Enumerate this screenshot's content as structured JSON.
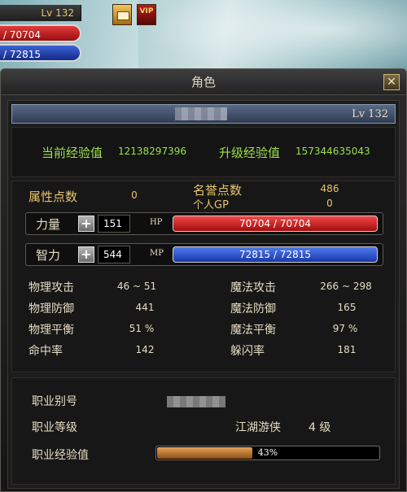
{
  "hud": {
    "level": "Lv 132",
    "hp_text": "/ 70704",
    "mp_text": "/ 72815",
    "icons": [
      "scroll-icon",
      "vip-icon"
    ],
    "vip_label": "VIP"
  },
  "window": {
    "title": "角色",
    "close_label": "✕"
  },
  "character": {
    "name": "",
    "level": "Lv 132"
  },
  "experience": {
    "current_label": "当前经验值",
    "current_value": "12138297396",
    "next_label": "升级经验值",
    "next_value": "157344635043"
  },
  "points": {
    "attr_label": "属性点数",
    "attr_value": "0",
    "fame_label": "名誉点数",
    "fame_value": "486",
    "gp_label": "个人GP",
    "gp_value": "0"
  },
  "stats": {
    "str_label": "力量",
    "str_value": "151",
    "int_label": "智力",
    "int_value": "544",
    "plus": "+"
  },
  "bars": {
    "hp_tag": "HP",
    "hp_text": "70704 / 70704",
    "hp_fraction": 1.0,
    "mp_tag": "MP",
    "mp_text": "72815 / 72815",
    "mp_fraction": 1.0
  },
  "combat": [
    {
      "label": "物理攻击",
      "value": "46 ~ 51"
    },
    {
      "label": "魔法攻击",
      "value": "266 ~ 298"
    },
    {
      "label": "物理防御",
      "value": "441"
    },
    {
      "label": "魔法防御",
      "value": "165"
    },
    {
      "label": "物理平衡",
      "value": "51 %"
    },
    {
      "label": "魔法平衡",
      "value": "97 %"
    },
    {
      "label": "命中率",
      "value": "142"
    },
    {
      "label": "躲闪率",
      "value": "181"
    }
  ],
  "job": {
    "alias_label": "职业别号",
    "alias_value": "",
    "level_label": "职业等级",
    "class_name": "江湖游侠",
    "class_level": "4 级",
    "exp_label": "职业经验值",
    "exp_percent": 43,
    "exp_text": "43%"
  },
  "colors": {
    "accent_gold": "#e8c56a",
    "exp_green": "#9ee04c",
    "hp_red": "#d41f1f",
    "mp_blue": "#2a4fd0",
    "job_exp_orange": "#c7813a"
  }
}
